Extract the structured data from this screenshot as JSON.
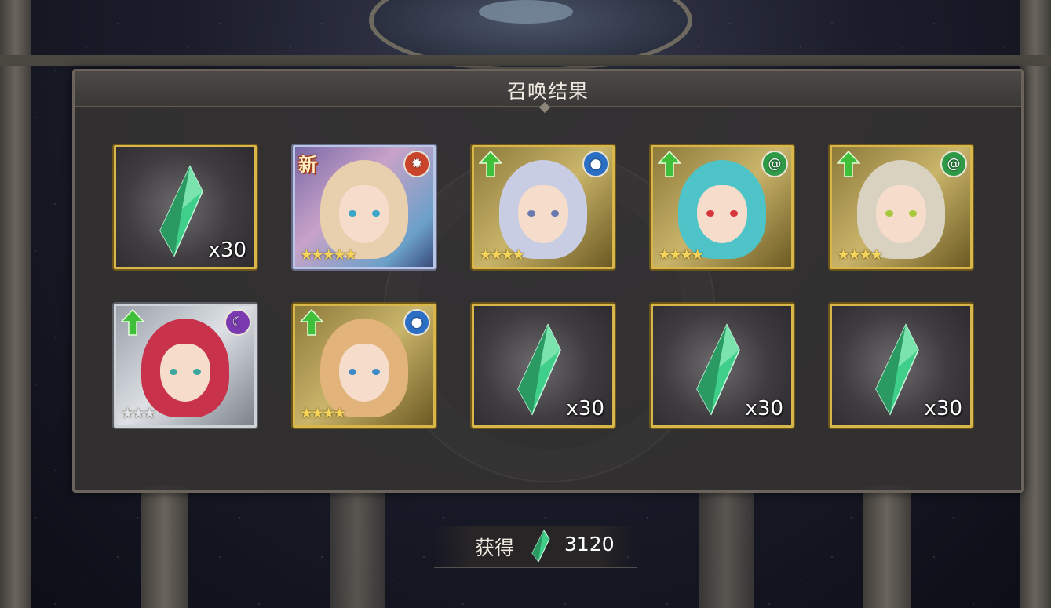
{
  "panel": {
    "title": "召唤结果"
  },
  "tiles": [
    {
      "kind": "item",
      "quantity": "x30"
    },
    {
      "kind": "character",
      "badge_new": "新",
      "element": "fire",
      "element_color": "#c8442a",
      "stars": "★★★★★",
      "rarity": "rainbow",
      "hair_color": "#e8cfae",
      "eye_color": "#3aa6c8"
    },
    {
      "kind": "character",
      "upgrade": true,
      "element": "water",
      "element_color": "#2a6fc4",
      "stars": "★★★★",
      "rarity": "gold",
      "hair_color": "#c9cde4",
      "eye_color": "#6a7ab0"
    },
    {
      "kind": "character",
      "upgrade": true,
      "element": "wind",
      "element_color": "#2e9a48",
      "stars": "★★★★",
      "rarity": "gold",
      "hair_color": "#4fc4c8",
      "eye_color": "#d8343c"
    },
    {
      "kind": "character",
      "upgrade": true,
      "element": "wind",
      "element_color": "#2e9a48",
      "stars": "★★★★",
      "rarity": "gold",
      "hair_color": "#d9d2c0",
      "eye_color": "#a6c83a"
    },
    {
      "kind": "character",
      "upgrade": true,
      "element": "dark",
      "element_color": "#7a3ab0",
      "stars": "★★★",
      "rarity": "silver",
      "hair_color": "#c8324a",
      "eye_color": "#3aa6a0"
    },
    {
      "kind": "character",
      "upgrade": true,
      "element": "water",
      "element_color": "#2a6fc4",
      "stars": "★★★★",
      "rarity": "gold",
      "hair_color": "#e2b37a",
      "eye_color": "#3a8ac8"
    },
    {
      "kind": "item",
      "quantity": "x30"
    },
    {
      "kind": "item",
      "quantity": "x30"
    },
    {
      "kind": "item",
      "quantity": "x30"
    }
  ],
  "summary": {
    "label": "获得",
    "value": "3120",
    "icon": "green-crystal-icon"
  },
  "colors": {
    "gold_frame": "#d9b64a",
    "crystal_green": "#3fcf8a",
    "upgrade_arrow": "#3fbf3a",
    "star_gold": "#f7d55a",
    "star_silver": "#dfe3e8"
  }
}
